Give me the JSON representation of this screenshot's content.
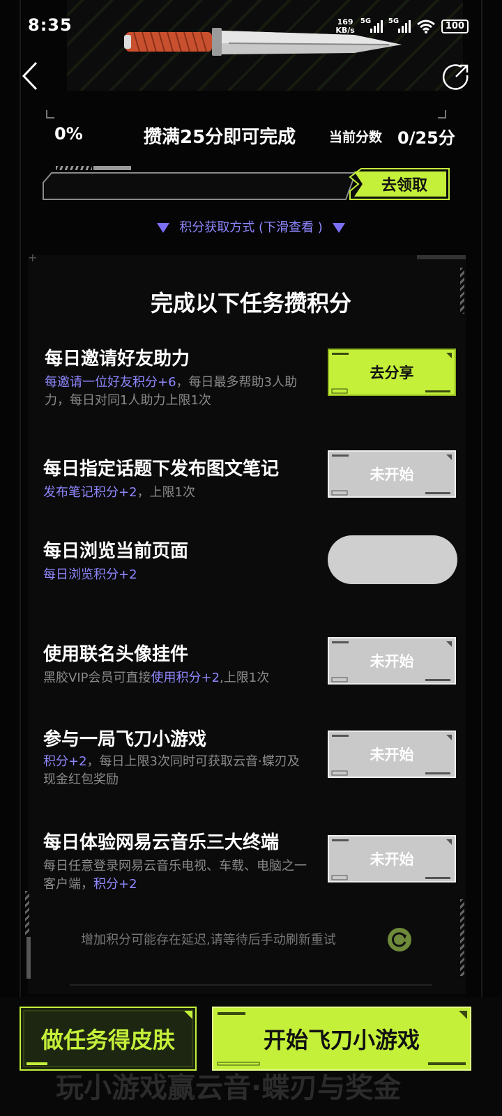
{
  "status_bar": {
    "time": "8:35",
    "net_speed_value": "169",
    "net_speed_unit": "KB/s",
    "signal1": "5G",
    "signal2": "5G",
    "battery": "100"
  },
  "progress": {
    "percent": "0%",
    "goal_text": "攒满25分即可完成",
    "score_label": "当前分数",
    "score_value": "0/25分",
    "fill_fraction": 0,
    "claim_button": "去领取"
  },
  "points_hint": "积分获取方式 (下滑查看 )",
  "panel_title": "完成以下任务攒积分",
  "tasks": [
    {
      "title": "每日邀请好友助力",
      "desc_highlight": "每邀请一位好友积分+6",
      "desc_rest": "，每日最多帮助3人助力，每日对同1人助力上限1次",
      "button": "去分享",
      "button_style": "green"
    },
    {
      "title": "每日指定话题下发布图文笔记",
      "desc_highlight": "发布笔记积分+2",
      "desc_rest": "，上限1次",
      "button": "未开始",
      "button_style": "gray"
    },
    {
      "title": "每日浏览当前页面",
      "desc_highlight": "每日浏览积分+2",
      "desc_rest": "",
      "button": "",
      "button_style": "pill"
    },
    {
      "title": "使用联名头像挂件",
      "desc_prefix": "黑胶VIP会员可直接",
      "desc_highlight": "使用积分+2",
      "desc_rest": ",上限1次",
      "button": "未开始",
      "button_style": "gray"
    },
    {
      "title": "参与一局飞刀小游戏",
      "desc_highlight": "积分+2",
      "desc_rest": "，每日上限3次同时可获取云音·蝶刃及现金红包奖励",
      "button": "未开始",
      "button_style": "gray"
    },
    {
      "title": "每日体验网易云音乐三大终端",
      "desc_prefix": "每日任意登录网易云音乐电视、车载、电脑之一客户端，",
      "desc_highlight": "积分+2",
      "desc_rest": "",
      "button": "未开始",
      "button_style": "gray"
    }
  ],
  "footer_note": "增加积分可能存在延迟,请等待后手动刷新重试",
  "bottom": {
    "skin_button": "做任务得皮肤",
    "game_button": "开始飞刀小游戏",
    "ghost_text": "玩小游戏赢云音·蝶刃与奖金"
  },
  "colors": {
    "accent_green": "#c4f03a",
    "highlight_purple": "#8f87ff",
    "disabled_gray": "#cfcfcf"
  },
  "icons": [
    "back-arrow-icon",
    "share-icon",
    "refresh-icon",
    "knife-image",
    "triangle-down-icon"
  ]
}
